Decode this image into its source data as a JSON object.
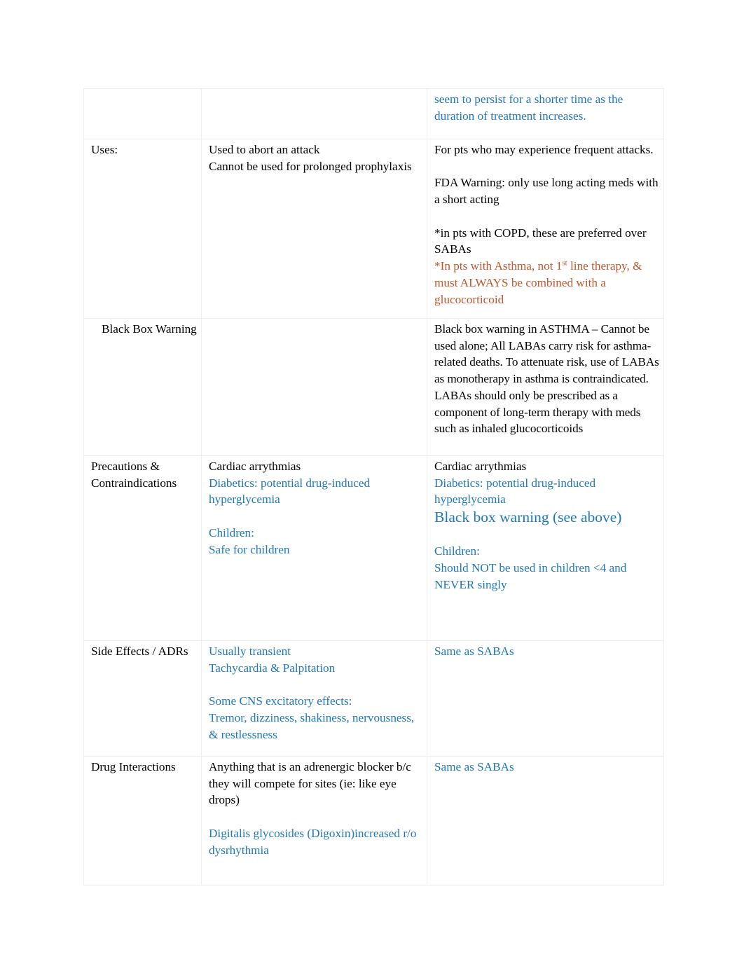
{
  "document": {
    "type": "drug-comparison-table",
    "colors": {
      "blue": "#1f78bd",
      "orange": "#c1562c",
      "black": "#000000",
      "border": "#eeeeee",
      "page_background": "#ffffff"
    },
    "columns": 3,
    "rows": [
      {
        "id": "continued-row",
        "label": "",
        "col2": "",
        "col3_blue": "seem to persist for a shorter time as the duration of treatment increases."
      },
      {
        "id": "uses",
        "label": "Uses:",
        "col2": "Used to abort an attack\nCannot be used for prolonged prophylaxis",
        "col3_black_1": "For pts who may experience frequent attacks.",
        "col3_black_2": "FDA Warning: only use long acting meds with a short acting",
        "col3_black_3": "*in pts with COPD, these are preferred over SABAs",
        "col3_orange_pre": "*In pts with Asthma, not 1",
        "col3_orange_sup": "st",
        "col3_orange_post": " line therapy, & must ALWAYS be combined with a glucocorticoid"
      },
      {
        "id": "black-box-warning",
        "label": "Black Box Warning",
        "col2": "",
        "col3_black": "Black box warning in ASTHMA – Cannot be used alone; All LABAs carry risk for asthma-related deaths.    To attenuate risk, use of LABAs as monotherapy in asthma is contraindicated. LABAs should only be prescribed as a component of long-term therapy with meds such as inhaled glucocorticoids"
      },
      {
        "id": "precautions-contraindications",
        "label": "Precautions & Contraindications",
        "col2_black": "Cardiac arrythmias",
        "col2_blue_1": "Diabetics: potential drug-induced hyperglycemia",
        "col2_blue_2": "Children:\nSafe for children",
        "col3_black": "Cardiac arrythmias",
        "col3_blue_1": "Diabetics: potential drug-induced hyperglycemia",
        "col3_blue_big": "Black box warning (see above)",
        "col3_blue_2": "Children:\nShould NOT be used in children <4 and NEVER singly"
      },
      {
        "id": "side-effects-adrs",
        "label": "Side Effects / ADRs",
        "col2_blue_1": "Usually transient\nTachycardia & Palpitation",
        "col2_blue_2": "Some CNS excitatory effects:\nTremor, dizziness, shakiness, nervousness, & restlessness",
        "col3_blue": "Same as SABAs"
      },
      {
        "id": "drug-interactions",
        "label": "Drug Interactions",
        "col2_black": "Anything that is an adrenergic blocker b/c they will compete for sites (ie: like eye drops)",
        "col2_blue": "Digitalis glycosides (Digoxin)increased r/o dysrhythmia",
        "col3_blue": "Same as SABAs"
      }
    ]
  }
}
